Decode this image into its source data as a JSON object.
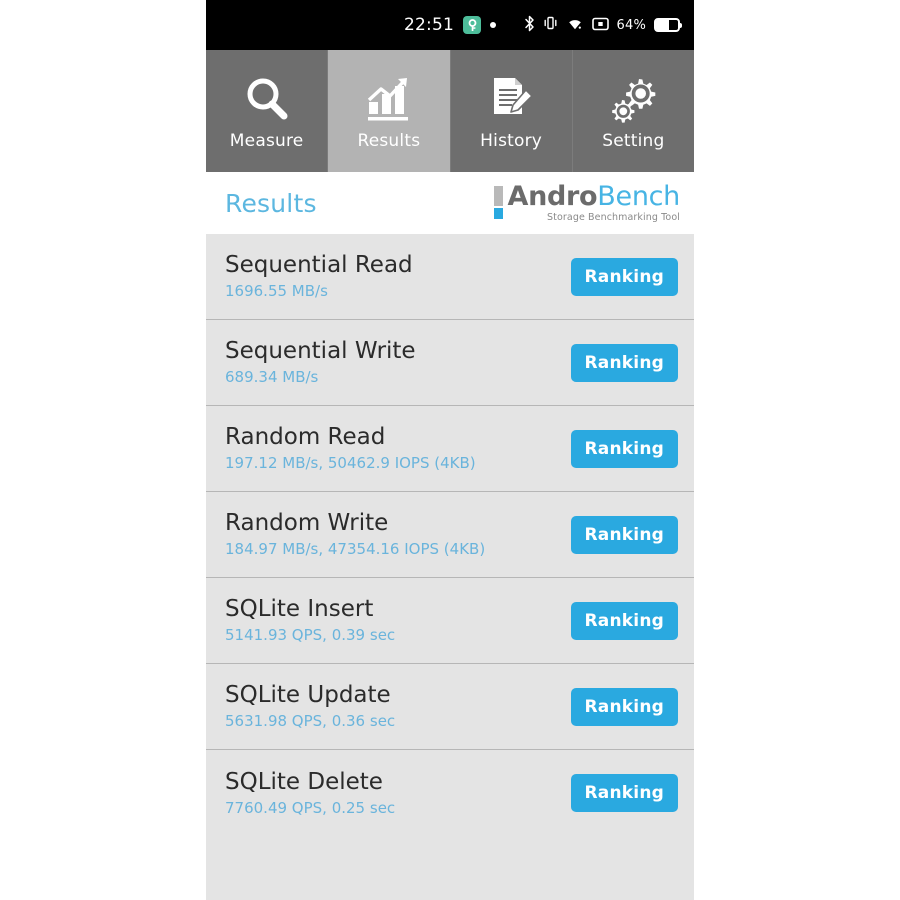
{
  "status_bar": {
    "time": "22:51",
    "badge_icon": "key-badge-icon",
    "badge_color": "#4dbd9a",
    "notification_dot": "notification-dot-icon",
    "bluetooth_icon": "bluetooth-icon",
    "vibrate_icon": "vibrate-icon",
    "wifi_icon": "wifi-icon",
    "screenshot_icon": "screen-record-icon",
    "battery_percent": "64%",
    "battery_icon": "battery-icon"
  },
  "tabs": [
    {
      "label": "Measure",
      "icon": "search-icon",
      "active": false
    },
    {
      "label": "Results",
      "icon": "chart-icon",
      "active": true
    },
    {
      "label": "History",
      "icon": "document-edit-icon",
      "active": false
    },
    {
      "label": "Setting",
      "icon": "gears-icon",
      "active": false
    }
  ],
  "header": {
    "title": "Results",
    "title_color": "#5cb7e0",
    "logo": {
      "part1": "Andro",
      "part2": "Bench",
      "tagline": "Storage Benchmarking Tool",
      "part1_color": "#6b6b6b",
      "part2_color": "#47b4e4"
    }
  },
  "results": {
    "button_label": "Ranking",
    "button_color": "#2aa9e0",
    "rows": [
      {
        "name": "Sequential Read",
        "value": "1696.55 MB/s"
      },
      {
        "name": "Sequential Write",
        "value": "689.34 MB/s"
      },
      {
        "name": "Random Read",
        "value": "197.12 MB/s, 50462.9 IOPS (4KB)"
      },
      {
        "name": "Random Write",
        "value": "184.97 MB/s, 47354.16 IOPS (4KB)"
      },
      {
        "name": "SQLite Insert",
        "value": "5141.93 QPS, 0.39 sec"
      },
      {
        "name": "SQLite Update",
        "value": "5631.98 QPS, 0.36 sec"
      },
      {
        "name": "SQLite Delete",
        "value": "7760.49 QPS, 0.25 sec"
      }
    ]
  }
}
